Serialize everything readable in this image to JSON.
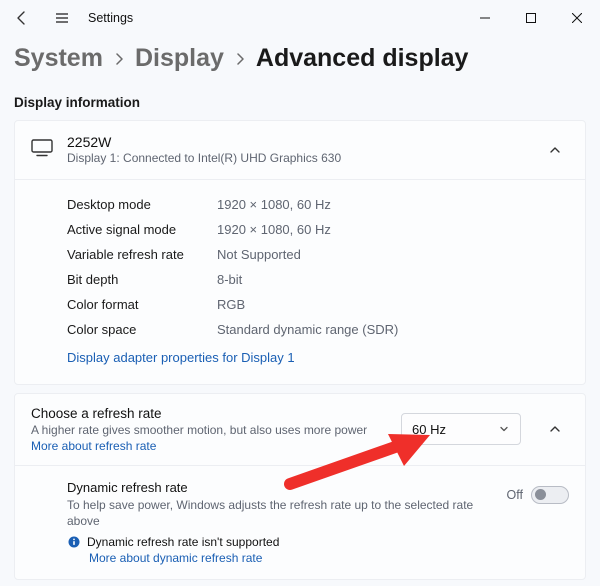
{
  "titlebar": {
    "title": "Settings"
  },
  "breadcrumb": {
    "item1": "System",
    "item2": "Display",
    "item3": "Advanced display"
  },
  "section_title": "Display information",
  "display": {
    "name": "2252W",
    "subtitle": "Display 1: Connected to Intel(R) UHD Graphics 630",
    "props": {
      "desktop_mode": {
        "label": "Desktop mode",
        "value": "1920 × 1080, 60 Hz"
      },
      "active_signal_mode": {
        "label": "Active signal mode",
        "value": "1920 × 1080, 60 Hz"
      },
      "variable_refresh": {
        "label": "Variable refresh rate",
        "value": "Not Supported"
      },
      "bit_depth": {
        "label": "Bit depth",
        "value": "8-bit"
      },
      "color_format": {
        "label": "Color format",
        "value": "RGB"
      },
      "color_space": {
        "label": "Color space",
        "value": "Standard dynamic range (SDR)"
      }
    },
    "adapter_link": "Display adapter properties for Display 1"
  },
  "refresh_rate": {
    "title": "Choose a refresh rate",
    "subtitle": "A higher rate gives smoother motion, but also uses more power",
    "link": "More about refresh rate",
    "selected": "60 Hz"
  },
  "dynamic_refresh": {
    "title": "Dynamic refresh rate",
    "subtitle": "To help save power, Windows adjusts the refresh rate up to the selected rate above",
    "note": "Dynamic refresh rate isn't supported",
    "link": "More about dynamic refresh rate",
    "toggle_label": "Off"
  }
}
